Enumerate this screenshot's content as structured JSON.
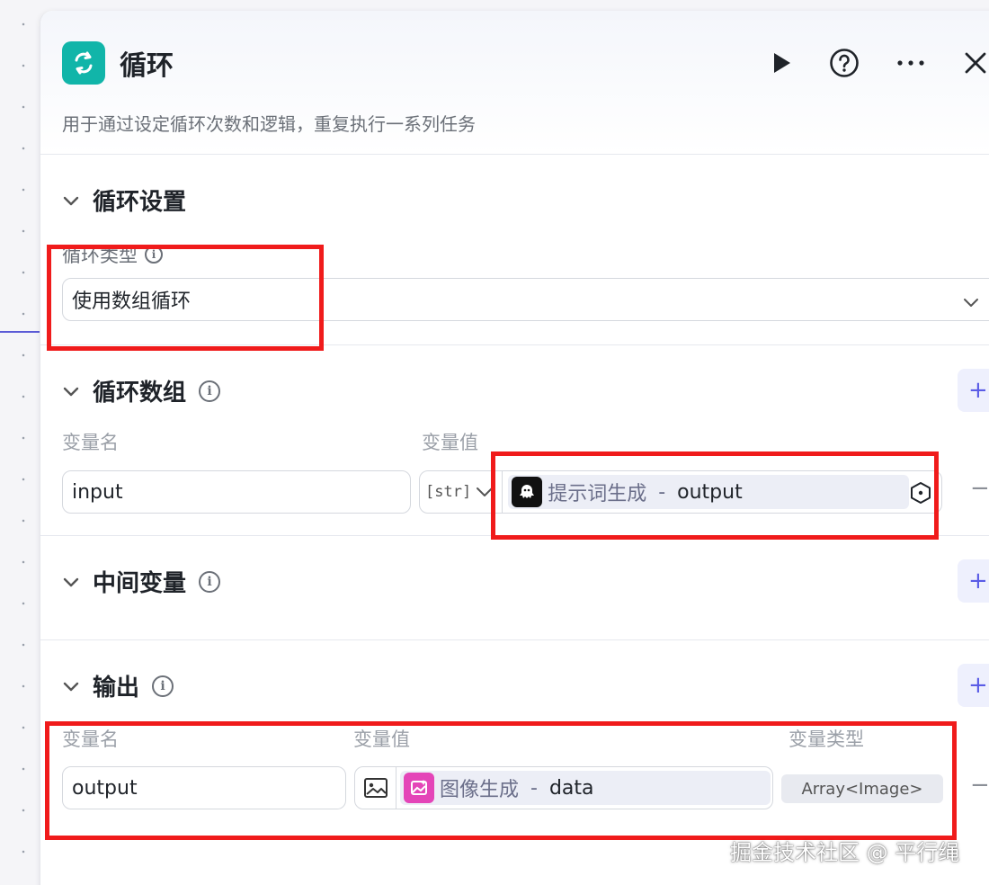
{
  "node": {
    "title": "循环",
    "description": "用于通过设定循环次数和逻辑，重复执行一系列任务",
    "accent": "#11b5a9"
  },
  "loop_settings": {
    "title": "循环设置",
    "type_label": "循环类型",
    "type_value": "使用数组循环"
  },
  "loop_array": {
    "title": "循环数组",
    "col_name": "变量名",
    "col_value": "变量值",
    "var_name": "input",
    "type_tag": "[str]",
    "ref_source": "提示词生成",
    "ref_separator": " - ",
    "ref_field": "output"
  },
  "intermediate": {
    "title": "中间变量"
  },
  "output": {
    "title": "输出",
    "col_name": "变量名",
    "col_value": "变量值",
    "col_type": "变量类型",
    "var_name": "output",
    "ref_source": "图像生成",
    "ref_separator": " - ",
    "ref_field": "data",
    "var_type": "Array<Image>"
  },
  "buttons": {
    "add": "+",
    "remove": "−"
  },
  "watermark": "掘金技术社区 @ 平行绳",
  "colors": {
    "highlight": "#f01b1b",
    "add_button": "#5a5ce6"
  }
}
